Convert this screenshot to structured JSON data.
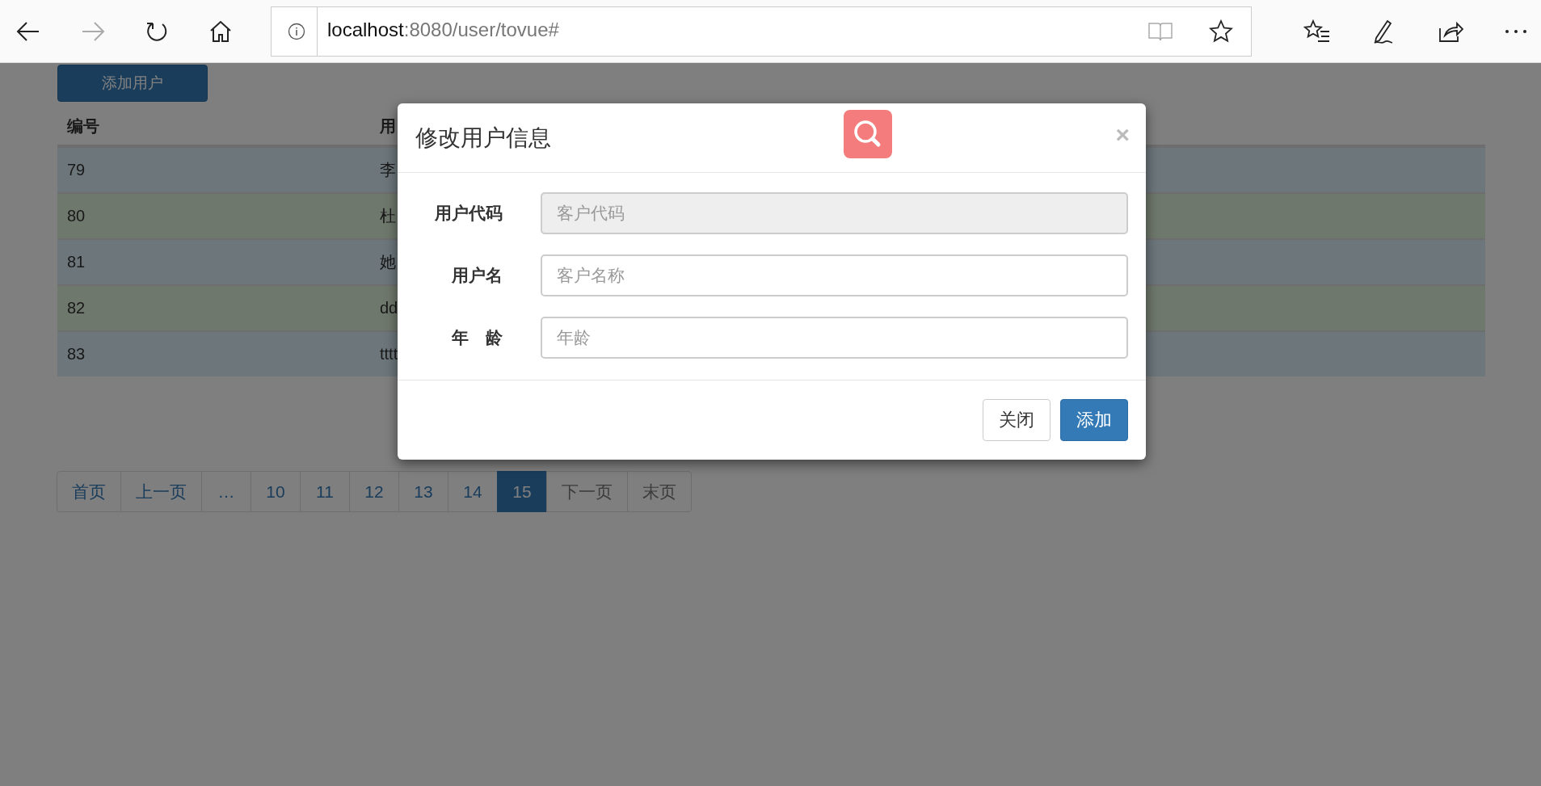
{
  "browser": {
    "back": {
      "disabled": false
    },
    "forward": {
      "disabled": true
    },
    "address": {
      "host": "localhost",
      "path": ":8080/user/tovue#"
    }
  },
  "add_button": "添加用户",
  "table": {
    "columns": [
      "编号",
      "用"
    ],
    "rows": [
      {
        "kind": "info",
        "cells": [
          "79",
          "李"
        ]
      },
      {
        "kind": "success",
        "cells": [
          "80",
          "杜"
        ]
      },
      {
        "kind": "info",
        "cells": [
          "81",
          "她"
        ]
      },
      {
        "kind": "success",
        "cells": [
          "82",
          "dd"
        ]
      },
      {
        "kind": "info",
        "cells": [
          "83",
          "tttt"
        ]
      }
    ]
  },
  "pagination": [
    {
      "label": "首页",
      "selected": false,
      "disabled": false
    },
    {
      "label": "上一页",
      "selected": false,
      "disabled": false
    },
    {
      "label": "…",
      "selected": false,
      "disabled": false
    },
    {
      "label": "10",
      "selected": false,
      "disabled": false
    },
    {
      "label": "11",
      "selected": false,
      "disabled": false
    },
    {
      "label": "12",
      "selected": false,
      "disabled": false
    },
    {
      "label": "13",
      "selected": false,
      "disabled": false
    },
    {
      "label": "14",
      "selected": false,
      "disabled": false
    },
    {
      "label": "15",
      "selected": true,
      "disabled": false
    },
    {
      "label": "下一页",
      "selected": false,
      "disabled": true
    },
    {
      "label": "末页",
      "selected": false,
      "disabled": true
    }
  ],
  "modal": {
    "title": "修改用户信息",
    "close": "×",
    "fields": [
      {
        "label": "用户代码",
        "placeholder": "客户代码",
        "disabled": true
      },
      {
        "label": "用户名",
        "placeholder": "客户名称",
        "disabled": false
      },
      {
        "label": "年　龄",
        "placeholder": "年龄",
        "disabled": false
      }
    ],
    "buttons": [
      {
        "label": "关闭",
        "kind": "default"
      },
      {
        "label": "添加",
        "kind": "primary"
      }
    ]
  }
}
